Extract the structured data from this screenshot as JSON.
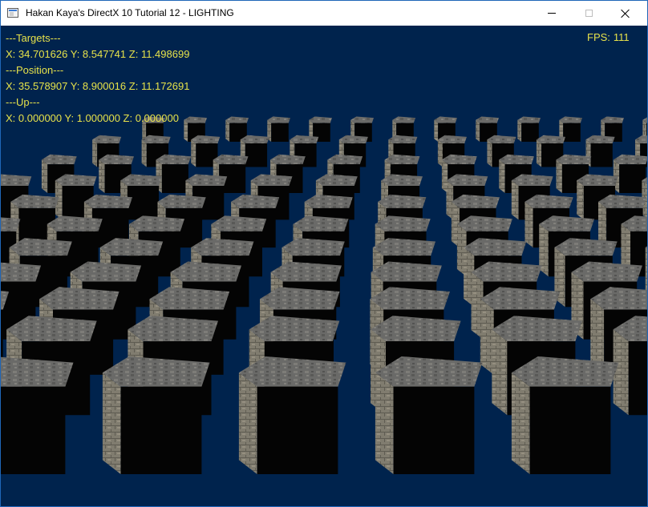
{
  "window": {
    "title": "Hakan Kaya's DirectX 10 Tutorial 12 - LIGHTING",
    "icon": "application-icon",
    "controls": [
      "minimize-icon",
      "maximize-icon",
      "close-icon"
    ]
  },
  "hud": {
    "targets_header": "---Targets---",
    "targets": {
      "x": "34.701626",
      "y": "8.547741",
      "z": "11.498699"
    },
    "position_header": "---Position---",
    "position": {
      "x": "35.578907",
      "y": "8.900016",
      "z": "11.172691"
    },
    "up_header": "---Up---",
    "up": {
      "x": "0.000000",
      "y": "1.000000",
      "z": "0.000000"
    },
    "fps_label": "FPS:",
    "fps_value": "111"
  },
  "colors": {
    "background": "#00234d",
    "hud_text": "#e7e24a",
    "cube_top": "#6e6e6e",
    "cube_lit_side": "#7a776e",
    "cube_dark_side": "#040404"
  }
}
